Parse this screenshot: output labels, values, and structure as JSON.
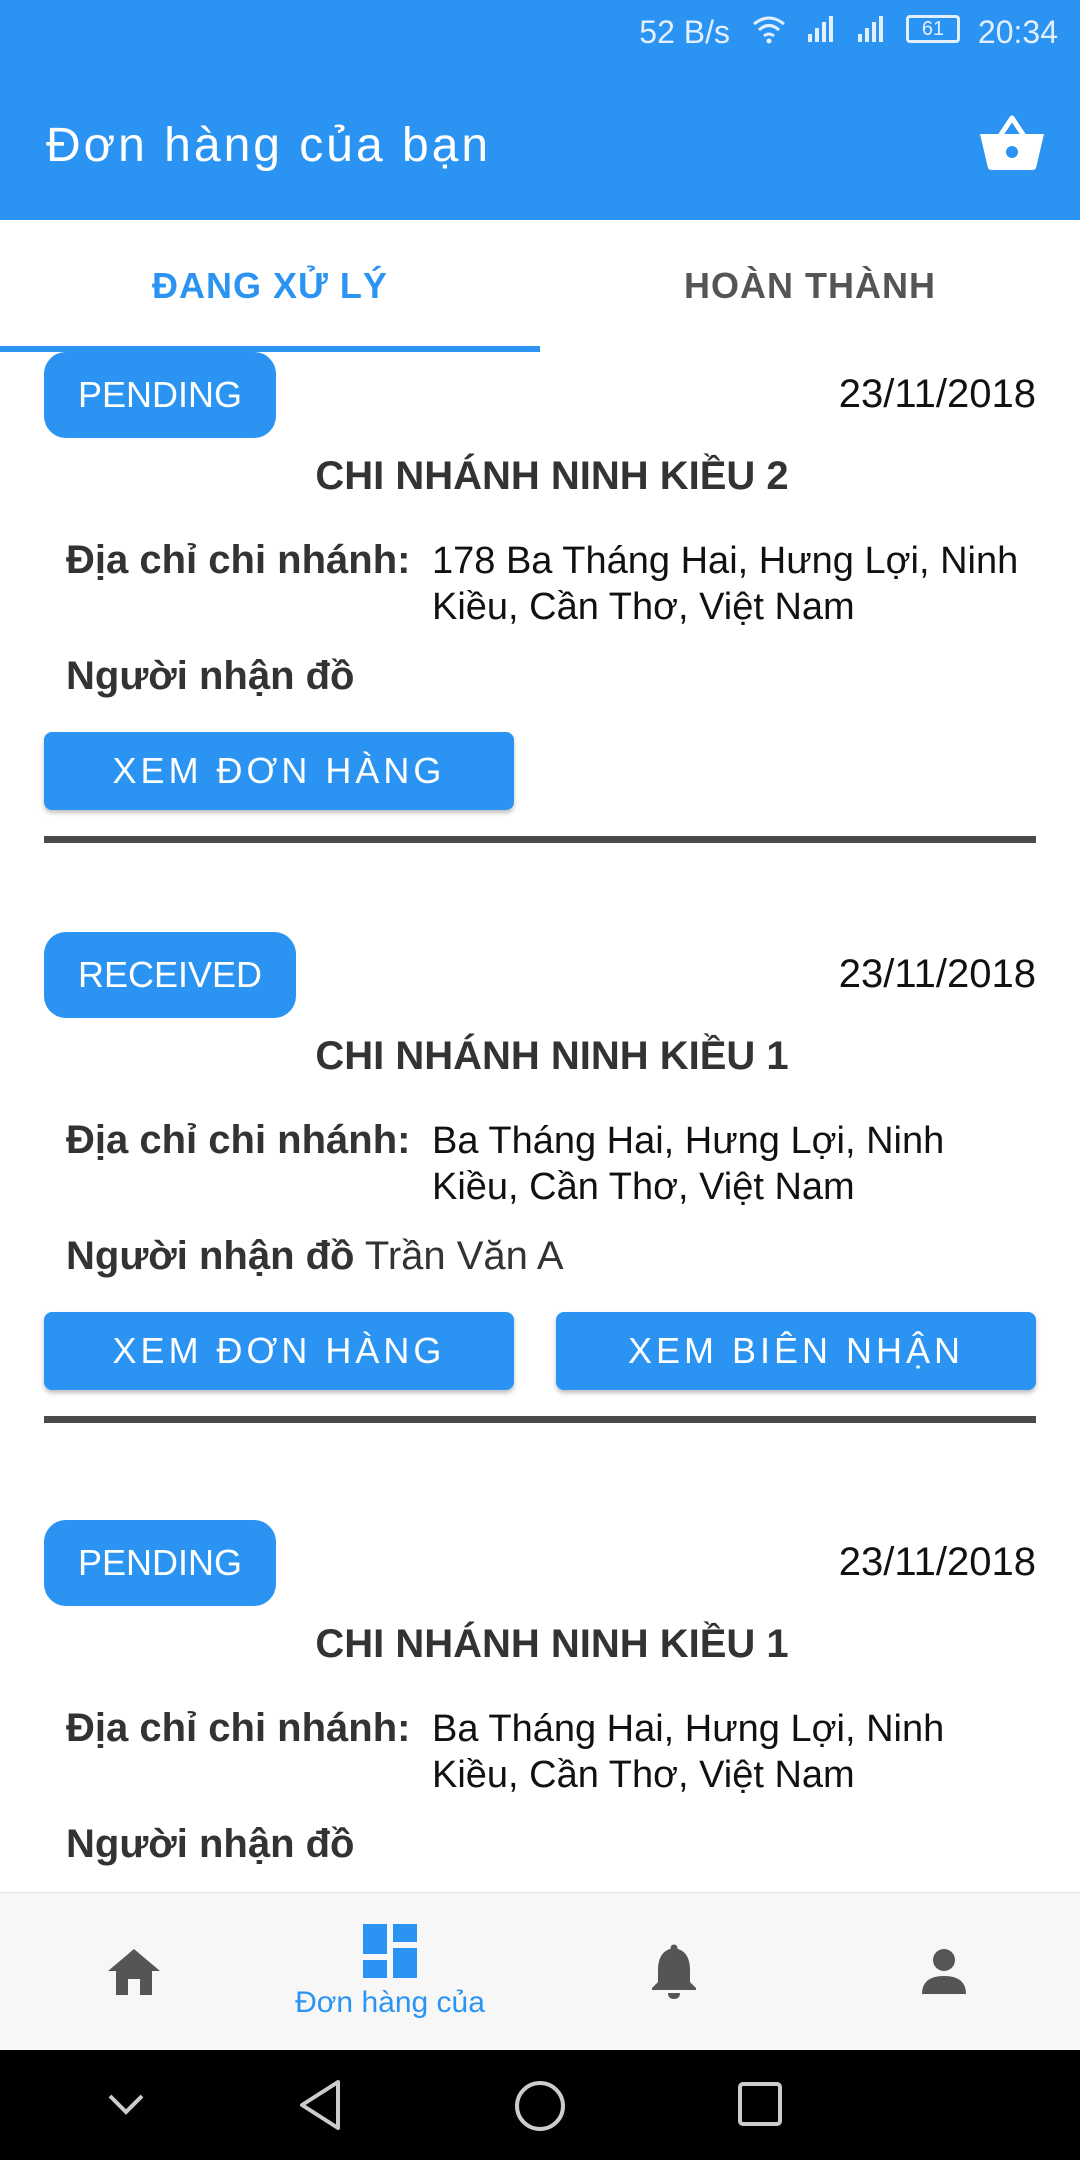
{
  "status_bar": {
    "speed": "52 B/s",
    "battery": "61",
    "time": "20:34"
  },
  "app_bar": {
    "title": "Đơn hàng của bạn",
    "cart_icon": "basket-icon"
  },
  "tabs": [
    {
      "label": "ĐANG XỬ LÝ",
      "active": true
    },
    {
      "label": "HOÀN THÀNH",
      "active": false
    }
  ],
  "labels": {
    "address": "Địa chỉ chi nhánh:",
    "receiver": "Người nhận đồ",
    "view_order": "XEM ĐƠN HÀNG",
    "view_receipt": "XEM BIÊN NHẬN"
  },
  "orders": [
    {
      "status": "PENDING",
      "date": "23/11/2018",
      "branch": "CHI NHÁNH NINH KIỀU 2",
      "address": "178 Ba Tháng Hai, Hưng Lợi, Ninh Kiều, Cần Thơ, Việt Nam",
      "receiver": ""
    },
    {
      "status": "RECEIVED",
      "date": "23/11/2018",
      "branch": "CHI NHÁNH NINH KIỀU 1",
      "address": "Ba Tháng Hai, Hưng Lợi, Ninh Kiều, Cần Thơ, Việt Nam",
      "receiver": "Trần Văn A"
    },
    {
      "status": "PENDING",
      "date": "23/11/2018",
      "branch": "CHI NHÁNH NINH KIỀU 1",
      "address": "Ba Tháng Hai, Hưng Lợi, Ninh Kiều, Cần Thơ, Việt Nam",
      "receiver": ""
    }
  ],
  "bottom_nav": [
    {
      "icon": "home-icon",
      "label": ""
    },
    {
      "icon": "dashboard-icon",
      "label": "Đơn hàng của",
      "active": true
    },
    {
      "icon": "bell-icon",
      "label": ""
    },
    {
      "icon": "person-icon",
      "label": ""
    }
  ],
  "colors": {
    "primary": "#2b94f2",
    "divider": "#4a4a4a",
    "inactive_icon": "#555555"
  }
}
